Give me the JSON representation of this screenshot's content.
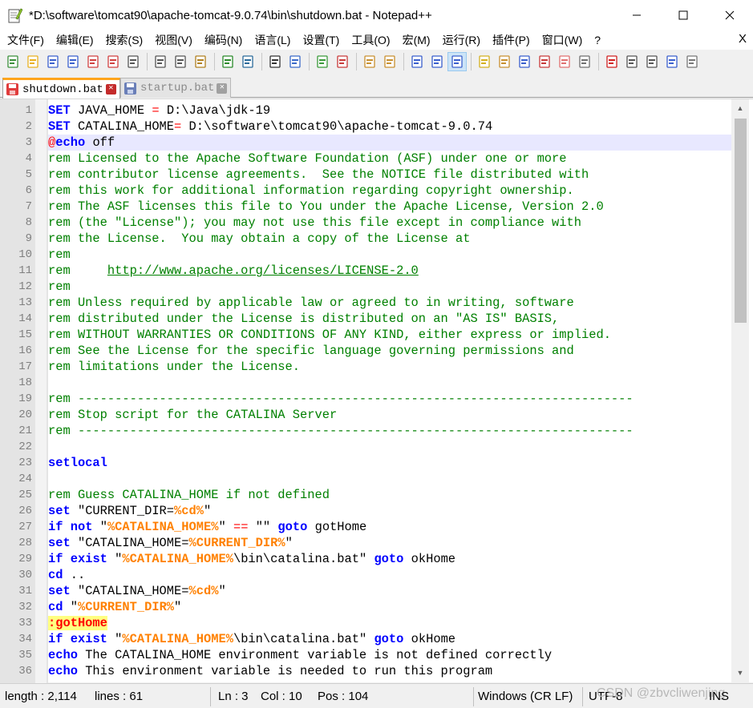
{
  "window": {
    "title": "*D:\\software\\tomcat90\\apache-tomcat-9.0.74\\bin\\shutdown.bat - Notepad++"
  },
  "menu": [
    "文件(F)",
    "编辑(E)",
    "搜索(S)",
    "视图(V)",
    "编码(N)",
    "语言(L)",
    "设置(T)",
    "工具(O)",
    "宏(M)",
    "运行(R)",
    "插件(P)",
    "窗口(W)",
    "?"
  ],
  "menu_close": "X",
  "tabs": [
    {
      "label": "shutdown.bat",
      "active": true,
      "modified": true
    },
    {
      "label": "startup.bat",
      "active": false,
      "modified": false
    }
  ],
  "editor": {
    "current_line": 3,
    "lines": [
      [
        [
          "SET",
          "kw"
        ],
        [
          " JAVA_HOME ",
          "t"
        ],
        [
          "=",
          "op"
        ],
        [
          " D:\\Java\\jdk-19",
          "t"
        ]
      ],
      [
        [
          "SET",
          "kw"
        ],
        [
          " CATALINA_HOME",
          "t"
        ],
        [
          "=",
          "op"
        ],
        [
          " D:\\software\\tomcat90\\apache-tomcat-9.0.74",
          "t"
        ]
      ],
      [
        [
          "@",
          "at"
        ],
        [
          "echo",
          "kw"
        ],
        [
          " off",
          "t"
        ]
      ],
      [
        [
          "rem Licensed to the Apache Software Foundation (ASF) under one or more",
          "cm"
        ]
      ],
      [
        [
          "rem contributor license agreements.  See the NOTICE file distributed with",
          "cm"
        ]
      ],
      [
        [
          "rem this work for additional information regarding copyright ownership.",
          "cm"
        ]
      ],
      [
        [
          "rem The ASF licenses this file to You under the Apache License, Version 2.0",
          "cm"
        ]
      ],
      [
        [
          "rem (the \"License\"); you may not use this file except in compliance with",
          "cm"
        ]
      ],
      [
        [
          "rem the License.  You may obtain a copy of the License at",
          "cm"
        ]
      ],
      [
        [
          "rem",
          "cm"
        ]
      ],
      [
        [
          "rem     ",
          "cm"
        ],
        [
          "http://www.apache.org/licenses/LICENSE-2.0",
          "url"
        ]
      ],
      [
        [
          "rem",
          "cm"
        ]
      ],
      [
        [
          "rem Unless required by applicable law or agreed to in writing, software",
          "cm"
        ]
      ],
      [
        [
          "rem distributed under the License is distributed on an \"AS IS\" BASIS,",
          "cm"
        ]
      ],
      [
        [
          "rem WITHOUT WARRANTIES OR CONDITIONS OF ANY KIND, either express or implied.",
          "cm"
        ]
      ],
      [
        [
          "rem See the License for the specific language governing permissions and",
          "cm"
        ]
      ],
      [
        [
          "rem limitations under the License.",
          "cm"
        ]
      ],
      [],
      [
        [
          "rem ---------------------------------------------------------------------------",
          "cm"
        ]
      ],
      [
        [
          "rem Stop script for the CATALINA Server",
          "cm"
        ]
      ],
      [
        [
          "rem ---------------------------------------------------------------------------",
          "cm"
        ]
      ],
      [],
      [
        [
          "setlocal",
          "kw"
        ]
      ],
      [],
      [
        [
          "rem Guess CATALINA_HOME if not defined",
          "cm"
        ]
      ],
      [
        [
          "set",
          "kw"
        ],
        [
          " \"CURRENT_DIR=",
          "t"
        ],
        [
          "%cd%",
          "var"
        ],
        [
          "\"",
          "t"
        ]
      ],
      [
        [
          "if",
          "kw"
        ],
        [
          " ",
          "t"
        ],
        [
          "not",
          "kw"
        ],
        [
          " \"",
          "t"
        ],
        [
          "%CATALINA_HOME%",
          "var"
        ],
        [
          "\" ",
          "t"
        ],
        [
          "==",
          "op"
        ],
        [
          " \"\" ",
          "t"
        ],
        [
          "goto",
          "kw"
        ],
        [
          " gotHome",
          "t"
        ]
      ],
      [
        [
          "set",
          "kw"
        ],
        [
          " \"CATALINA_HOME=",
          "t"
        ],
        [
          "%CURRENT_DIR%",
          "var"
        ],
        [
          "\"",
          "t"
        ]
      ],
      [
        [
          "if",
          "kw"
        ],
        [
          " ",
          "t"
        ],
        [
          "exist",
          "kw"
        ],
        [
          " \"",
          "t"
        ],
        [
          "%CATALINA_HOME%",
          "var"
        ],
        [
          "\\bin\\catalina.bat\" ",
          "t"
        ],
        [
          "goto",
          "kw"
        ],
        [
          " okHome",
          "t"
        ]
      ],
      [
        [
          "cd",
          "kw"
        ],
        [
          " ..",
          "t"
        ]
      ],
      [
        [
          "set",
          "kw"
        ],
        [
          " \"CATALINA_HOME=",
          "t"
        ],
        [
          "%cd%",
          "var"
        ],
        [
          "\"",
          "t"
        ]
      ],
      [
        [
          "cd",
          "kw"
        ],
        [
          " \"",
          "t"
        ],
        [
          "%CURRENT_DIR%",
          "var"
        ],
        [
          "\"",
          "t"
        ]
      ],
      [
        [
          ":gotHome",
          "lbl"
        ]
      ],
      [
        [
          "if",
          "kw"
        ],
        [
          " ",
          "t"
        ],
        [
          "exist",
          "kw"
        ],
        [
          " \"",
          "t"
        ],
        [
          "%CATALINA_HOME%",
          "var"
        ],
        [
          "\\bin\\catalina.bat\" ",
          "t"
        ],
        [
          "goto",
          "kw"
        ],
        [
          " okHome",
          "t"
        ]
      ],
      [
        [
          "echo",
          "kw"
        ],
        [
          " The CATALINA_HOME environment variable is not defined correctly",
          "t"
        ]
      ],
      [
        [
          "echo",
          "kw"
        ],
        [
          " This environment variable is needed to run this program",
          "t"
        ]
      ]
    ]
  },
  "colors": {
    "kw": "#0000ff",
    "t": "#000000",
    "op": "#ff0000",
    "at": "#ff0000",
    "cm": "#008000",
    "url": "#008000",
    "var": "#ff8000",
    "lbl": "#ff0000",
    "lbl_bg": "#ffff80",
    "current_line_bg": "#e8e8ff",
    "tab_accent": "#ffa51d"
  },
  "status": {
    "length": "length : 2,114",
    "lines": "lines : 61",
    "ln": "Ln : 3",
    "col": "Col : 10",
    "pos": "Pos : 104",
    "eol": "Windows (CR LF)",
    "encoding": "UTF-8",
    "mode": "INS",
    "watermark": "CSDN @zbvcliwenjing"
  },
  "toolbar_icons": [
    "new-file-icon",
    "open-file-icon",
    "save-icon",
    "save-all-icon",
    "close-icon",
    "close-all-icon",
    "print-icon",
    "cut-icon",
    "copy-icon",
    "paste-icon",
    "undo-icon",
    "redo-icon",
    "find-icon",
    "replace-icon",
    "zoom-in-icon",
    "zoom-out-icon",
    "sync-vertical-icon",
    "sync-horizontal-icon",
    "word-wrap-icon",
    "show-all-chars-icon",
    "indent-guide-icon",
    "language-icon",
    "doc-map-icon",
    "function-list-icon",
    "doc-list-icon",
    "folder-workspace-icon",
    "monitor-icon",
    "record-macro-icon",
    "stop-record-icon",
    "play-macro-icon",
    "run-macro-multiple-icon",
    "save-macro-icon"
  ]
}
